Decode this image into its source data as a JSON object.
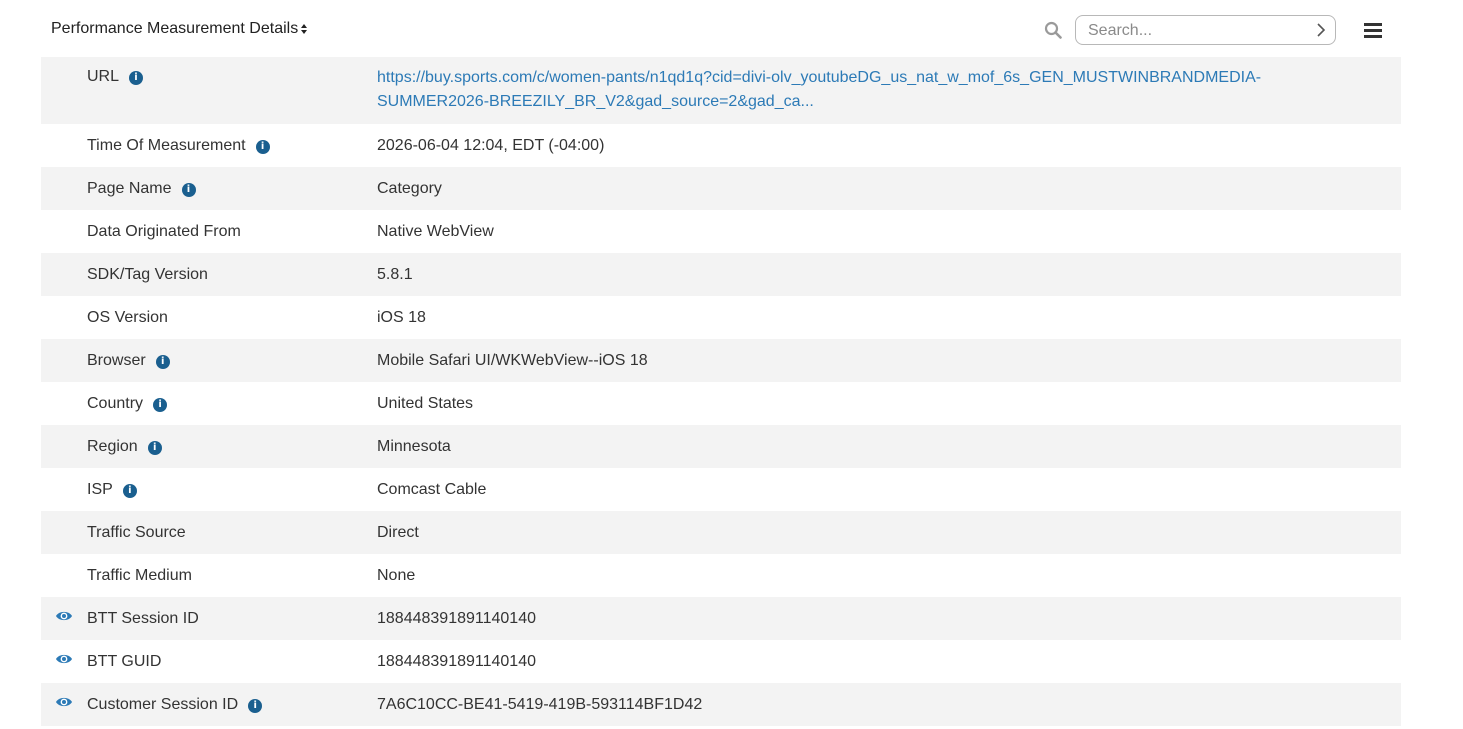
{
  "header": {
    "title": "Performance Measurement Details",
    "search_placeholder": "Search...",
    "icons": {
      "search": "search-icon",
      "submit": "chevron-right-icon",
      "menu": "hamburger-menu-icon",
      "sort": "sort-icon"
    }
  },
  "colors": {
    "row_alt": "#f3f3f3",
    "link": "#2c7ab6",
    "info_icon": "#1a5f8f",
    "eye_icon": "#2c7ab6"
  },
  "rows": [
    {
      "label": "URL",
      "value_line1": "https://buy.sports.com/c/women-pants/n1qd1q?cid=divi-olv_youtubeDG_us_nat_w_mof_6s_GEN_MUSTWINBRANDMEDIA-",
      "value_line2": "SUMMER2026-BREEZILY_BR_V2&gad_source=2&gad_ca...",
      "info": true,
      "eye": false
    },
    {
      "label": "Time Of Measurement",
      "value": "2026-06-04 12:04, EDT (-04:00)",
      "info": true,
      "eye": false
    },
    {
      "label": "Page Name",
      "value": "Category",
      "info": true,
      "eye": false
    },
    {
      "label": "Data Originated From",
      "value": "Native WebView",
      "info": false,
      "eye": false
    },
    {
      "label": "SDK/Tag Version",
      "value": "5.8.1",
      "info": false,
      "eye": false
    },
    {
      "label": "OS Version",
      "value": "iOS 18",
      "info": false,
      "eye": false
    },
    {
      "label": "Browser",
      "value": "Mobile Safari UI/WKWebView--iOS 18",
      "info": true,
      "eye": false
    },
    {
      "label": "Country",
      "value": "United States",
      "info": true,
      "eye": false
    },
    {
      "label": "Region",
      "value": "Minnesota",
      "info": true,
      "eye": false
    },
    {
      "label": "ISP",
      "value": "Comcast Cable",
      "info": true,
      "eye": false
    },
    {
      "label": "Traffic Source",
      "value": "Direct",
      "info": false,
      "eye": false
    },
    {
      "label": "Traffic Medium",
      "value": "None",
      "info": false,
      "eye": false
    },
    {
      "label": "BTT Session ID",
      "value": "188448391891140140",
      "info": false,
      "eye": true
    },
    {
      "label": "BTT GUID",
      "value": "188448391891140140",
      "info": false,
      "eye": true
    },
    {
      "label": "Customer Session ID",
      "value": "7A6C10CC-BE41-5419-419B-593114BF1D42",
      "info": true,
      "eye": true
    }
  ]
}
